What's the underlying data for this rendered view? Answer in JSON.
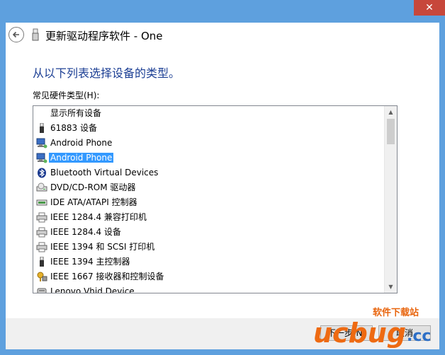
{
  "window": {
    "close_glyph": "✕"
  },
  "header": {
    "title": "更新驱动程序软件 - One"
  },
  "main": {
    "instruction": "从以下列表选择设备的类型。",
    "list_label": "常见硬件类型(H):",
    "items": [
      {
        "label": "显示所有设备",
        "icon": "none"
      },
      {
        "label": "61883 设备",
        "icon": "usb-plug-icon"
      },
      {
        "label": "Android Phone",
        "icon": "network-computer-icon"
      },
      {
        "label": "Android Phone",
        "icon": "network-computer-icon",
        "selected": true
      },
      {
        "label": "Bluetooth Virtual Devices",
        "icon": "bluetooth-icon"
      },
      {
        "label": "DVD/CD-ROM 驱动器",
        "icon": "optical-drive-icon"
      },
      {
        "label": "IDE ATA/ATAPI 控制器",
        "icon": "ide-controller-icon"
      },
      {
        "label": "IEEE 1284.4 兼容打印机",
        "icon": "printer-icon"
      },
      {
        "label": "IEEE 1284.4 设备",
        "icon": "printer-icon"
      },
      {
        "label": "IEEE 1394 和 SCSI 打印机",
        "icon": "printer-icon"
      },
      {
        "label": "IEEE 1394 主控制器",
        "icon": "usb-plug-icon"
      },
      {
        "label": "IEEE 1667 接收器和控制设备",
        "icon": "security-device-icon"
      },
      {
        "label": "Lenovo Vhid Device",
        "icon": "hid-icon"
      }
    ]
  },
  "footer": {
    "next_label": "下一步(N)",
    "cancel_label": "取消"
  },
  "watermark": {
    "site_text": "软件下载站",
    "logo_text": "ucbug",
    "logo_tld": ".cc"
  },
  "colors": {
    "accent": "#5ea0de",
    "instruction": "#1c3f94",
    "selection": "#3399ff"
  }
}
